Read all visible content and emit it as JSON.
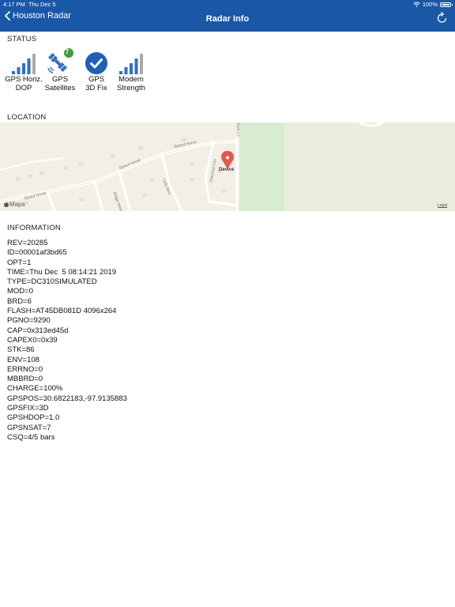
{
  "statusbar": {
    "time": "4:17 PM",
    "day": "Thu Dec 5",
    "battery": "100%"
  },
  "nav": {
    "back_label": "Houston Radar",
    "title": "Radar Info"
  },
  "sections": {
    "status": "STATUS",
    "location": "LOCATION",
    "information": "INFORMATION"
  },
  "status_items": [
    {
      "line1": "GPS Horiz.",
      "line2": "DOP",
      "icon": "signal-bars-icon"
    },
    {
      "line1": "GPS",
      "line2": "Satellites",
      "icon": "satellite-icon",
      "badge": "7"
    },
    {
      "line1": "GPS",
      "line2": "3D Fix",
      "icon": "checkmark-circle-icon"
    },
    {
      "line1": "Modem",
      "line2": "Strength",
      "icon": "signal-bars-icon"
    }
  ],
  "map": {
    "pin_label": "Device",
    "apple_maps": "Maps",
    "legal": "Legal",
    "streets": [
      "Speed Horse",
      "Speed Horse",
      "Speed Horse",
      "Chestnut Cov",
      "Lady Bird",
      "Ridge Horse",
      "Bark Ln"
    ]
  },
  "info_lines": [
    "REV=20285",
    "ID=00001af3bd65",
    "OPT=1",
    "TIME=Thu Dec  5 08:14:21 2019",
    "TYPE=DC310SIMULATED",
    "MOD=0",
    "BRD=6",
    "FLASH=AT45DB081D 4096x264",
    "PGNO=9290",
    "CAP=0x313ed45d",
    "CAPEX0=0x39",
    "STK=86",
    "ENV=108",
    "ERRNO=0",
    "MBBRD=0",
    "CHARGE=100%",
    "GPSPOS=30.6822183,-97.9135883",
    "GPSFIX=3D",
    "GPSHDOP=1.0",
    "GPSNSAT=7",
    "CSQ=4/5 bars"
  ],
  "colors": {
    "nav_bg": "#1958a7",
    "icon_blue": "#2f6fc7",
    "badge_green": "#3aa13a",
    "pin_red": "#e8574a",
    "park_green": "#d7ecd0"
  }
}
